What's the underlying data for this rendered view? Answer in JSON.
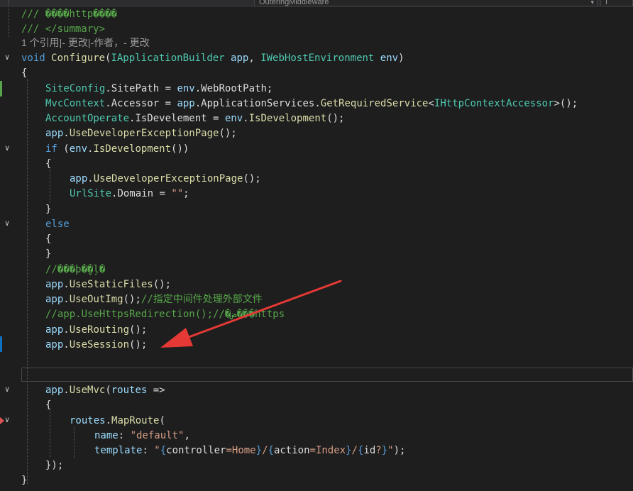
{
  "navbar": {
    "member_dropdown": "OuteringMiddleware",
    "right_dropdown": "I"
  },
  "code_lines": [
    {
      "text": "/// ����http����",
      "cls": "c-doc"
    },
    {
      "text": "/// </summary>",
      "cls": "c-doc"
    },
    {
      "text": "1 个引用|- 更改|-作者，- 更改",
      "cls": "c-ref"
    },
    {
      "text": "void Configure(IApplicationBuilder app, IWebHostEnvironment env)"
    },
    {
      "text": "{"
    },
    {
      "text": "SiteConfig.SitePath = env.WebRootPath;"
    },
    {
      "text": "MvcContext.Accessor = app.ApplicationServices.GetRequiredService<IHttpContextAccessor>();"
    },
    {
      "text": "AccountOperate.IsDevelement = env.IsDevelopment();"
    },
    {
      "text": "app.UseDeveloperExceptionPage();"
    },
    {
      "text": "if (env.IsDevelopment())"
    },
    {
      "text": "{"
    },
    {
      "text": "app.UseDeveloperExceptionPage();"
    },
    {
      "text": "UrlSite.Domain = \"\";"
    },
    {
      "text": "}"
    },
    {
      "text": "else"
    },
    {
      "text": "{"
    },
    {
      "text": "}"
    },
    {
      "text": "//���þ�̬�ļ�"
    },
    {
      "text": "app.UseStaticFiles();"
    },
    {
      "text": "app.UseOutImg();//指定中间件处理外部文件"
    },
    {
      "text": "//app.UseHttpsRedirection();//�ض���https"
    },
    {
      "text": "app.UseRouting();"
    },
    {
      "text": "app.UseSession();"
    },
    {
      "text": ""
    },
    {
      "text": ""
    },
    {
      "text": "app.UseMvc(routes =>"
    },
    {
      "text": "{"
    },
    {
      "text": "routes.MapRoute("
    },
    {
      "text": "name: \"default\","
    },
    {
      "text": "template: \"{controller=Home}/{action=Index}/{id?}\");"
    },
    {
      "text": "});"
    },
    {
      "text": "}"
    }
  ],
  "colors": {
    "background": "#1e1e1e",
    "keyword": "#569cd6",
    "type": "#4ec9b0",
    "method": "#dcdcaa",
    "string": "#d69d85",
    "comment": "#57a64a",
    "identifier": "#9cdcfe",
    "annotation_arrow": "#e53935"
  },
  "icons": {
    "fold": "collapse-chevron-icon",
    "breakpoint": "breakpoint-arrow-icon",
    "annotation": "red-arrow-annotation"
  }
}
